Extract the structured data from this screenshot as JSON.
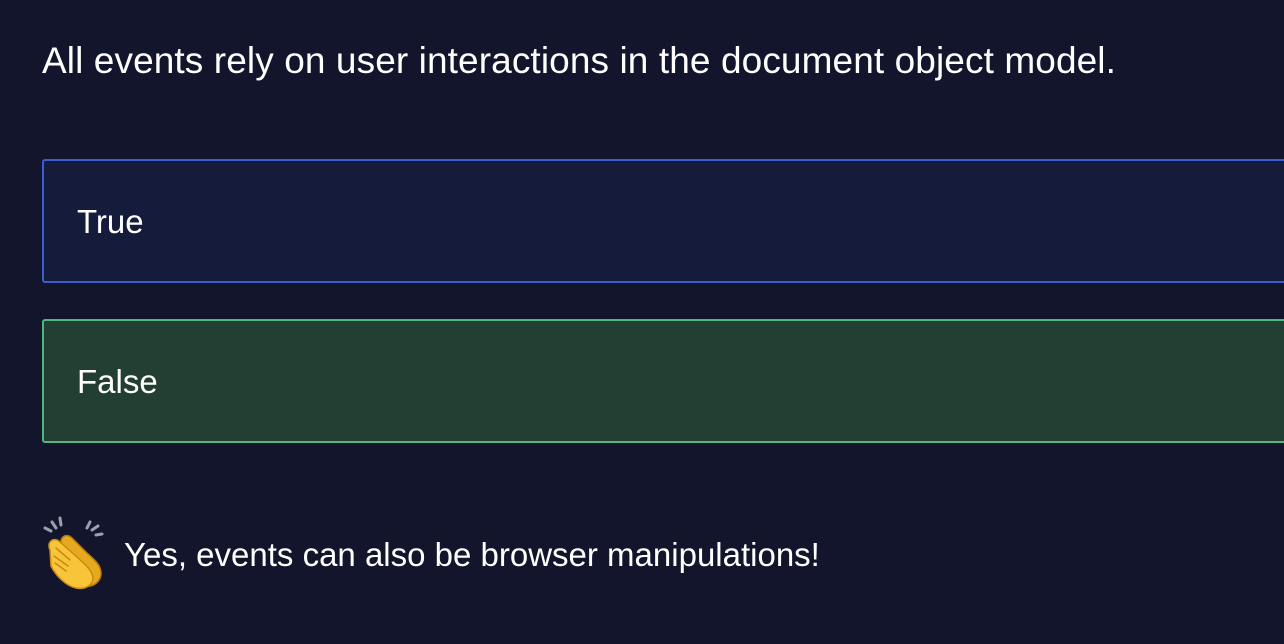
{
  "question": {
    "text": "All events rely on user interactions in the document object model."
  },
  "options": [
    {
      "label": "True",
      "state": "unselected",
      "accent": "#3d5bd0"
    },
    {
      "label": "False",
      "state": "correct",
      "accent": "#4cb882"
    }
  ],
  "feedback": {
    "icon": "clapping-hands-icon",
    "text": "Yes, events can also be browser manipulations!"
  },
  "colors": {
    "background": "#12152b",
    "option_default_bg": "#151b3b",
    "option_correct_bg": "#233f33"
  }
}
